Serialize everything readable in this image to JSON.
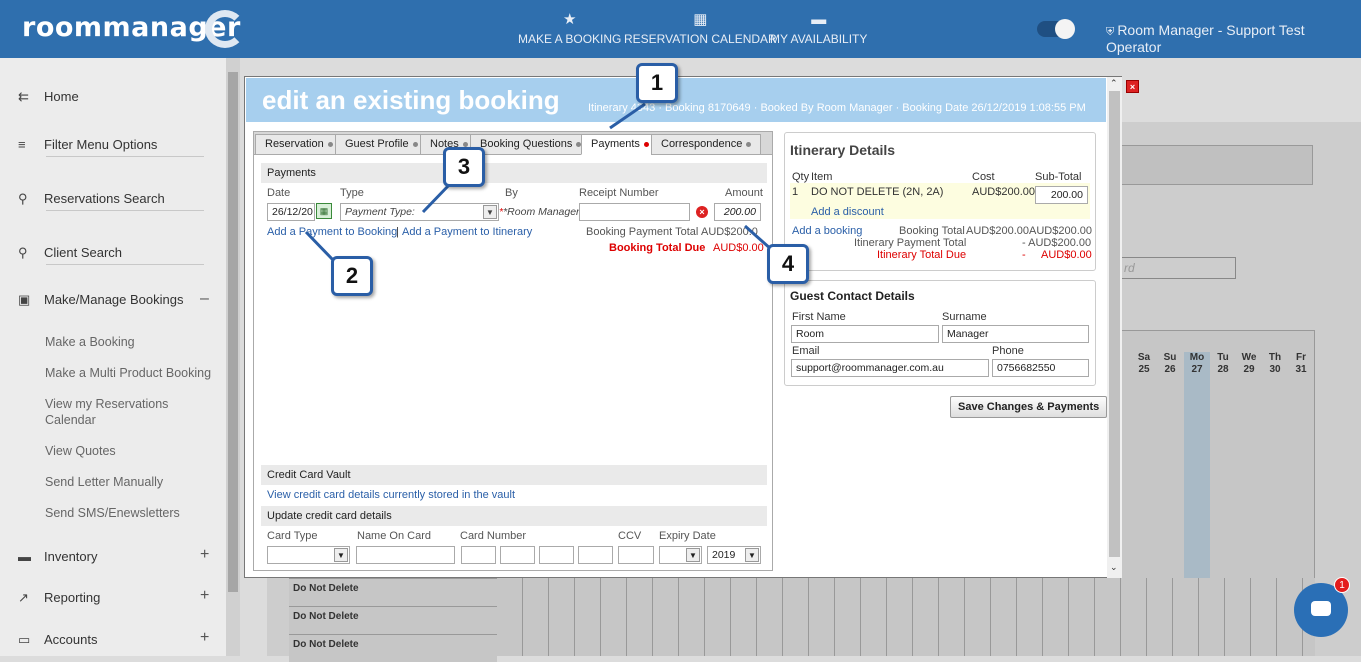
{
  "topbar": {
    "logo": "roommanager",
    "nav": [
      {
        "label": "MAKE A BOOKING",
        "icon": "star-icon"
      },
      {
        "label": "RESERVATION CALENDAR",
        "icon": "calendar-icon"
      },
      {
        "label": "MY AVAILABILITY",
        "icon": "bed-icon"
      }
    ],
    "user": "Room Manager - Support Test Operator"
  },
  "sidebar": {
    "items": [
      {
        "label": "Home",
        "icon": "back-arrow-icon"
      },
      {
        "label": "Filter Menu Options",
        "icon": "filter-icon"
      },
      {
        "label": "Reservations Search",
        "icon": "search-icon"
      },
      {
        "label": "Client Search",
        "icon": "search-icon"
      },
      {
        "label": "Make/Manage Bookings",
        "icon": "calendar-check-icon"
      }
    ],
    "subitems": [
      "Make a Booking",
      "Make a Multi Product Booking",
      "View my Reservations Calendar",
      "View Quotes",
      "Send Letter Manually",
      "Send SMS/Enewsletters"
    ],
    "bottom": [
      {
        "label": "Inventory",
        "icon": "bed-icon"
      },
      {
        "label": "Reporting",
        "icon": "trend-icon"
      },
      {
        "label": "Accounts",
        "icon": "card-icon"
      }
    ]
  },
  "background": {
    "days": [
      {
        "d": "Sa",
        "n": "25"
      },
      {
        "d": "Su",
        "n": "26"
      },
      {
        "d": "Mo",
        "n": "27"
      },
      {
        "d": "Tu",
        "n": "28"
      },
      {
        "d": "We",
        "n": "29"
      },
      {
        "d": "Th",
        "n": "30"
      },
      {
        "d": "Fr",
        "n": "31"
      }
    ],
    "rows": [
      "Do Not Delete",
      "Do Not Delete",
      "Do Not Delete"
    ],
    "hint": "rd"
  },
  "modal": {
    "title": "edit an existing booking",
    "subtitle": "Itinerary 4343 · Booking 8170649 · Booked By Room Manager · Booking Date 26/12/2019 1:08:55 PM",
    "tabs": [
      "Reservation",
      "Guest Profile",
      "Notes",
      "Booking Questions",
      "Payments",
      "Correspondence"
    ],
    "payments": {
      "section": "Payments",
      "headers": {
        "date": "Date",
        "type": "Type",
        "by": "By",
        "receipt": "Receipt Number",
        "amount": "Amount"
      },
      "date_value": "26/12/20",
      "type_placeholder": "Payment Type:",
      "by_value": "*Room Manager",
      "amount_value": "200.00",
      "link_booking": "Add a Payment to Booking",
      "link_itinerary": "Add a Payment to Itinerary",
      "separator": "|",
      "payment_total_label": "Booking Payment Total",
      "payment_total_value": "AUD$200.0",
      "total_due_label": "Booking Total Due",
      "total_due_value": "AUD$0.00"
    },
    "vault": {
      "section": "Credit Card Vault",
      "link": "View credit card details currently stored in the vault",
      "update_section": "Update credit card details",
      "headers": {
        "type": "Card Type",
        "name": "Name On Card",
        "number": "Card Number",
        "ccv": "CCV",
        "expiry": "Expiry Date"
      },
      "year": "2019"
    },
    "itinerary": {
      "title": "Itinerary Details",
      "headers": {
        "qty": "Qty",
        "item": "Item",
        "cost": "Cost",
        "subtotal": "Sub-Total"
      },
      "row": {
        "qty": "1",
        "item": "DO NOT DELETE (2N, 2A)",
        "cost": "AUD$200.00",
        "subtotal": "200.00"
      },
      "add_discount": "Add a discount",
      "add_booking": "Add a booking",
      "booking_total_label": "Booking Total",
      "booking_total_cost": "AUD$200.00",
      "booking_total_sub": "AUD$200.00",
      "itin_payment_label": "Itinerary Payment Total",
      "itin_payment_value": "- AUD$200.00",
      "itin_due_label": "Itinerary Total Due",
      "itin_due_dash": "-",
      "itin_due_value": "AUD$0.00"
    },
    "guest": {
      "title": "Guest Contact Details",
      "first_label": "First Name",
      "first": "Room",
      "surname_label": "Surname",
      "surname": "Manager",
      "email_label": "Email",
      "email": "support@roommanager.com.au",
      "phone_label": "Phone",
      "phone": "0756682550"
    },
    "save": "Save Changes & Payments"
  },
  "callouts": [
    "1",
    "2",
    "3",
    "4"
  ],
  "chat_badge": "1",
  "colors": {
    "header": "#2f6fae",
    "modal_header": "#a7cfee",
    "link": "#2a5fa8",
    "due": "#dd0000"
  }
}
